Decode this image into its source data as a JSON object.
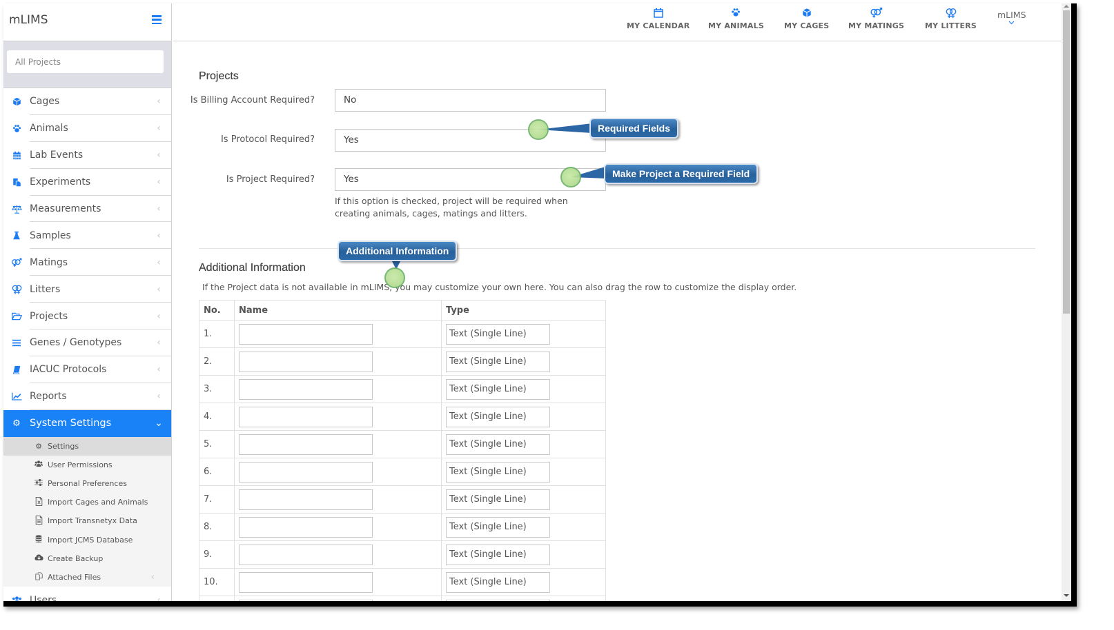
{
  "app": {
    "brand": "mLIMS",
    "project_selector_placeholder": "All Projects"
  },
  "sidebar": {
    "items": [
      {
        "label": "Cages",
        "icon": "cube-icon"
      },
      {
        "label": "Animals",
        "icon": "paw-icon"
      },
      {
        "label": "Lab Events",
        "icon": "calendar-icon"
      },
      {
        "label": "Experiments",
        "icon": "documents-icon"
      },
      {
        "label": "Measurements",
        "icon": "balance-scale-icon"
      },
      {
        "label": "Samples",
        "icon": "flask-icon"
      },
      {
        "label": "Matings",
        "icon": "mars-venus-icon"
      },
      {
        "label": "Litters",
        "icon": "venus-double-icon"
      },
      {
        "label": "Projects",
        "icon": "folder-open-icon"
      },
      {
        "label": "Genes / Genotypes",
        "icon": "list-icon"
      },
      {
        "label": "IACUC Protocols",
        "icon": "book-icon"
      },
      {
        "label": "Reports",
        "icon": "line-chart-icon"
      },
      {
        "label": "System Settings",
        "icon": "gear-icon",
        "active": true
      }
    ],
    "sub_items": [
      {
        "label": "Settings",
        "icon": "gear-icon",
        "active": true
      },
      {
        "label": "User Permissions",
        "icon": "users-icon"
      },
      {
        "label": "Personal Preferences",
        "icon": "sliders-icon"
      },
      {
        "label": "Import Cages and Animals",
        "icon": "excel-file-icon"
      },
      {
        "label": "Import Transnetyx Data",
        "icon": "text-file-icon"
      },
      {
        "label": "Import JCMS Database",
        "icon": "database-icon"
      },
      {
        "label": "Create Backup",
        "icon": "cloud-download-icon"
      },
      {
        "label": "Attached Files",
        "icon": "files-icon"
      }
    ],
    "after_items": [
      {
        "label": "Users",
        "icon": "users-icon"
      }
    ]
  },
  "topbar": {
    "links": [
      {
        "label": "MY CALENDAR",
        "icon": "calendar-icon"
      },
      {
        "label": "MY ANIMALS",
        "icon": "paw-icon"
      },
      {
        "label": "MY CAGES",
        "icon": "cube-icon"
      },
      {
        "label": "MY MATINGS",
        "icon": "mars-venus-icon"
      },
      {
        "label": "MY LITTERS",
        "icon": "venus-double-icon"
      }
    ],
    "user_menu": "mLIMS"
  },
  "projects_section": {
    "title": "Projects",
    "fields": [
      {
        "label": "Is Billing Account Required?",
        "value": "No"
      },
      {
        "label": "Is Protocol Required?",
        "value": "Yes"
      },
      {
        "label": "Is Project Required?",
        "value": "Yes"
      }
    ],
    "help_text": "If this option is checked, project will be required when creating animals, cages, matings and litters."
  },
  "additional_info": {
    "title": "Additional Information",
    "description": "If the Project data is not available in mLIMS, you may customize your own here. You can also drag the row to customize the display order.",
    "columns": [
      "No.",
      "Name",
      "Type"
    ],
    "rows": [
      {
        "no": "1.",
        "name": "",
        "type": "Text (Single Line)"
      },
      {
        "no": "2.",
        "name": "",
        "type": "Text (Single Line)"
      },
      {
        "no": "3.",
        "name": "",
        "type": "Text (Single Line)"
      },
      {
        "no": "4.",
        "name": "",
        "type": "Text (Single Line)"
      },
      {
        "no": "5.",
        "name": "",
        "type": "Text (Single Line)"
      },
      {
        "no": "6.",
        "name": "",
        "type": "Text (Single Line)"
      },
      {
        "no": "7.",
        "name": "",
        "type": "Text (Single Line)"
      },
      {
        "no": "8.",
        "name": "",
        "type": "Text (Single Line)"
      },
      {
        "no": "9.",
        "name": "",
        "type": "Text (Single Line)"
      },
      {
        "no": "10.",
        "name": "",
        "type": "Text (Single Line)"
      },
      {
        "no": "",
        "name": "",
        "type": ""
      }
    ]
  },
  "annotations": {
    "required_fields": "Required Fields",
    "make_project_required": "Make Project a Required Field",
    "additional_information": "Additional Information"
  },
  "colors": {
    "accent": "#1a82f7",
    "callout_blue": "#2b6aa8",
    "marker_green": "#a9d686"
  }
}
